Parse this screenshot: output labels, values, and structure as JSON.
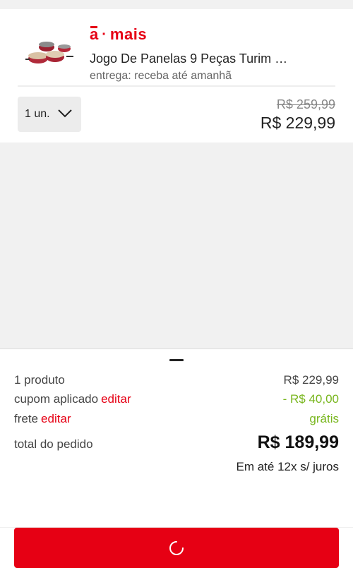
{
  "brand": {
    "a": "a",
    "dot": "·",
    "mais": "mais",
    "color": "#e60014"
  },
  "product": {
    "title": "Jogo De Panelas 9 Peças Turim …",
    "delivery": "entrega: receba até amanhã",
    "quantity": "1 un.",
    "old_price": "R$ 259,99",
    "price": "R$ 229,99",
    "image_icon": "cookware-set-image"
  },
  "summary": {
    "products_label": "1 produto",
    "products_value": "R$ 229,99",
    "coupon_label": "cupom aplicado",
    "coupon_edit": "editar",
    "coupon_value": "- R$ 40,00",
    "shipping_label": "frete",
    "shipping_edit": "editar",
    "shipping_value": "grátis",
    "total_label": "total do pedido",
    "total_value": "R$ 189,99",
    "installments": "Em até 12x s/ juros"
  },
  "cta": {
    "state": "loading",
    "icon": "spinner-icon",
    "color": "#e60014"
  },
  "colors": {
    "accent": "#e60014",
    "discount": "#78b61d"
  }
}
